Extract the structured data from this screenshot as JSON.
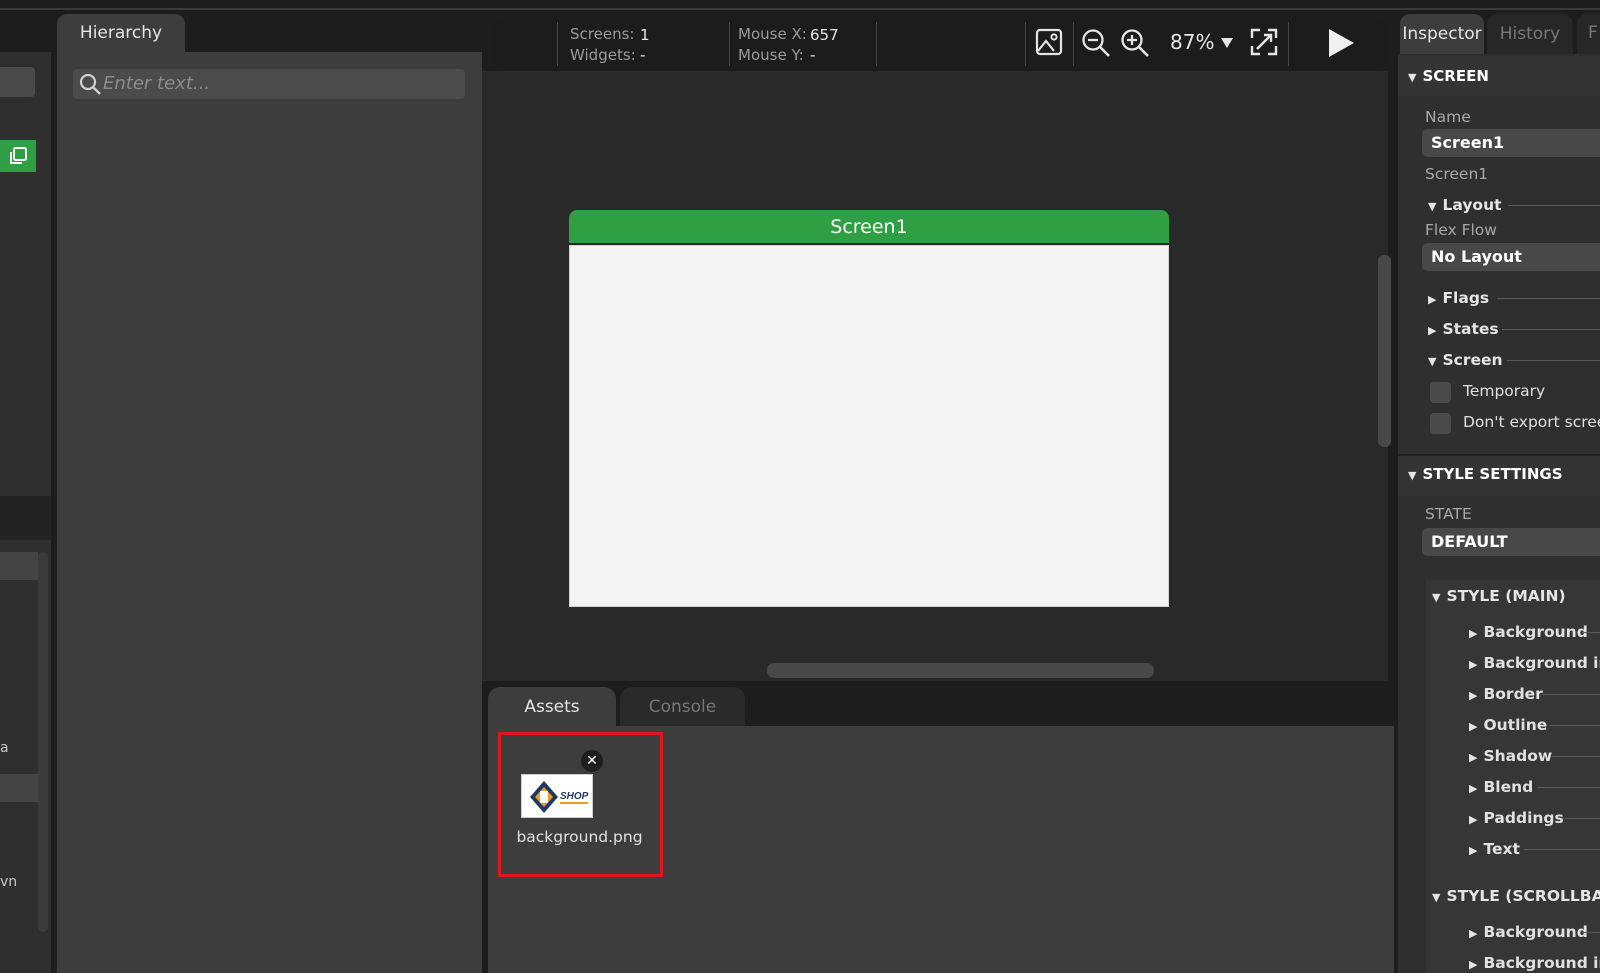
{
  "hierarchy": {
    "tab_label": "Hierarchy",
    "search_placeholder": "Enter text..."
  },
  "left_panel": {
    "truncated_a": "a",
    "truncated_wn": "vn"
  },
  "toolbar": {
    "screens_label": "Screens:",
    "screens_value": "1",
    "widgets_label": "Widgets:",
    "widgets_value": "-",
    "mouse_x_label": "Mouse X:",
    "mouse_x_value": "657",
    "mouse_y_label": "Mouse Y:",
    "mouse_y_value": "-",
    "zoom": "87%",
    "icons": [
      "image-icon",
      "zoom-out-icon",
      "zoom-in-icon",
      "chevron-down-icon",
      "fit-screen-icon",
      "play-icon"
    ]
  },
  "canvas": {
    "screen_title": "Screen1",
    "accent": "#2ea043"
  },
  "bottom": {
    "tabs": [
      "Assets",
      "Console"
    ],
    "assets": [
      {
        "name": "background.png",
        "thumb_logo": "SHOP"
      }
    ],
    "highlight_color": "#e0141c"
  },
  "inspector": {
    "tabs": [
      "Inspector",
      "History",
      "F"
    ],
    "screen_section": "SCREEN",
    "name_label": "Name",
    "name_value": "Screen1",
    "name_hint": "Screen1",
    "layout_label": "Layout",
    "flex_flow_label": "Flex Flow",
    "flex_flow_value": "No Layout",
    "flags_label": "Flags",
    "states_label": "States",
    "screen_label": "Screen",
    "temporary_label": "Temporary",
    "dont_export_label": "Don't export screen",
    "style_settings": "STYLE SETTINGS",
    "state_label": "STATE",
    "state_value": "DEFAULT",
    "style_main": "STYLE (MAIN)",
    "style_main_items": [
      "Background",
      "Background image",
      "Border",
      "Outline",
      "Shadow",
      "Blend",
      "Paddings",
      "Text"
    ],
    "style_scrollbar": "STYLE (SCROLLBAR)",
    "style_scrollbar_items": [
      "Background",
      "Background image"
    ]
  }
}
